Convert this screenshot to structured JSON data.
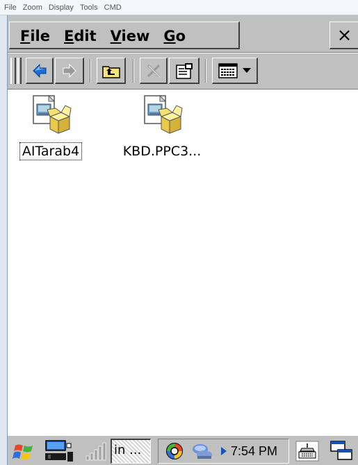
{
  "host_menu": {
    "items": [
      "File",
      "Zoom",
      "Display",
      "Tools",
      "CMD"
    ]
  },
  "menubar": {
    "items": [
      {
        "accel": "F",
        "rest": "ile"
      },
      {
        "accel": "E",
        "rest": "dit"
      },
      {
        "accel": "V",
        "rest": "iew"
      },
      {
        "accel": "G",
        "rest": "o"
      }
    ],
    "close_label": "×"
  },
  "toolbar": {
    "buttons": [
      "back-icon",
      "forward-icon",
      "up-folder-icon",
      "delete-icon",
      "properties-icon",
      "view-menu-icon"
    ]
  },
  "files": [
    {
      "name": "AITarab4",
      "icon": "cab-installer-icon",
      "focused": true
    },
    {
      "name": "KBD.PPC3...",
      "icon": "cab-installer-icon",
      "focused": false
    }
  ],
  "taskbar": {
    "task_label": "in ...",
    "clock": "7:54 PM",
    "icons": [
      "start-icon",
      "desktop-icon",
      "signal-icon",
      "messenger-icon",
      "network-icon",
      "input-panel-icon",
      "switch-windows-icon"
    ]
  },
  "colors": {
    "chrome": "#c0c0c0",
    "window": "#ffffff",
    "arrow_blue": "#1a6fd6"
  }
}
